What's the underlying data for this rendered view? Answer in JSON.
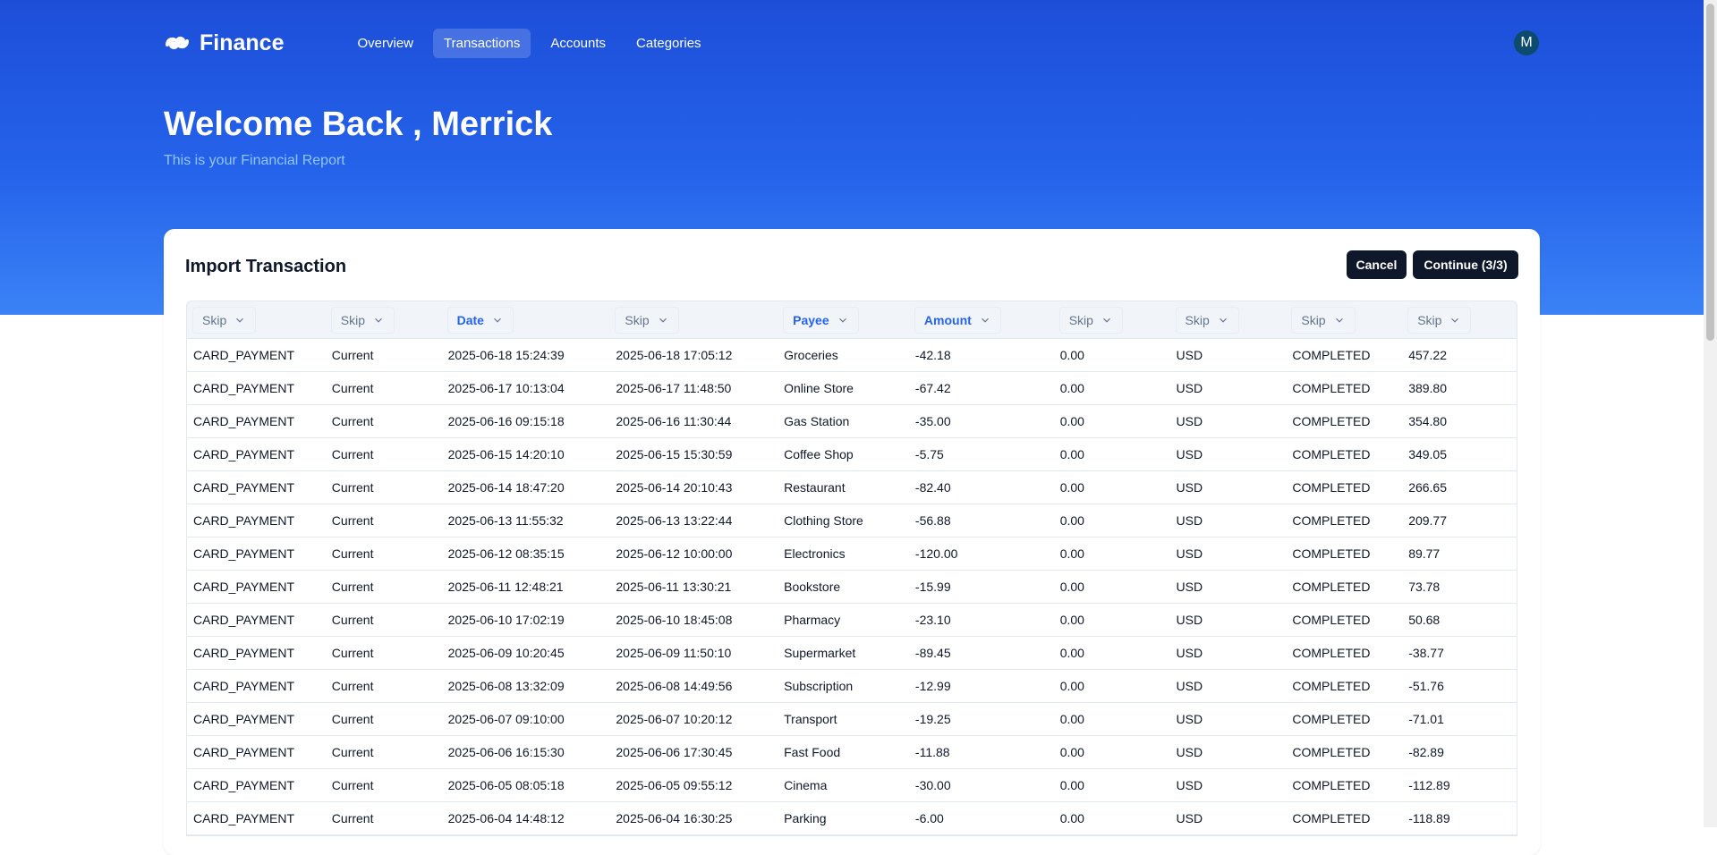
{
  "app": {
    "name": "Finance"
  },
  "nav": {
    "items": [
      {
        "label": "Overview"
      },
      {
        "label": "Transactions"
      },
      {
        "label": "Accounts"
      },
      {
        "label": "Categories"
      }
    ]
  },
  "user": {
    "initial": "M"
  },
  "header": {
    "welcome": "Welcome Back , Merrick",
    "subtitle": "This is your Financial Report"
  },
  "import": {
    "title": "Import Transaction",
    "cancel_label": "Cancel",
    "continue_label": "Continue (3/3)",
    "columns": [
      "Skip",
      "Skip",
      "Date",
      "Skip",
      "Payee",
      "Amount",
      "Skip",
      "Skip",
      "Skip",
      "Skip"
    ],
    "rows": [
      [
        "CARD_PAYMENT",
        "Current",
        "2025-06-18 15:24:39",
        "2025-06-18 17:05:12",
        "Groceries",
        "-42.18",
        "0.00",
        "USD",
        "COMPLETED",
        "457.22"
      ],
      [
        "CARD_PAYMENT",
        "Current",
        "2025-06-17 10:13:04",
        "2025-06-17 11:48:50",
        "Online Store",
        "-67.42",
        "0.00",
        "USD",
        "COMPLETED",
        "389.80"
      ],
      [
        "CARD_PAYMENT",
        "Current",
        "2025-06-16 09:15:18",
        "2025-06-16 11:30:44",
        "Gas Station",
        "-35.00",
        "0.00",
        "USD",
        "COMPLETED",
        "354.80"
      ],
      [
        "CARD_PAYMENT",
        "Current",
        "2025-06-15 14:20:10",
        "2025-06-15 15:30:59",
        "Coffee Shop",
        "-5.75",
        "0.00",
        "USD",
        "COMPLETED",
        "349.05"
      ],
      [
        "CARD_PAYMENT",
        "Current",
        "2025-06-14 18:47:20",
        "2025-06-14 20:10:43",
        "Restaurant",
        "-82.40",
        "0.00",
        "USD",
        "COMPLETED",
        "266.65"
      ],
      [
        "CARD_PAYMENT",
        "Current",
        "2025-06-13 11:55:32",
        "2025-06-13 13:22:44",
        "Clothing Store",
        "-56.88",
        "0.00",
        "USD",
        "COMPLETED",
        "209.77"
      ],
      [
        "CARD_PAYMENT",
        "Current",
        "2025-06-12 08:35:15",
        "2025-06-12 10:00:00",
        "Electronics",
        "-120.00",
        "0.00",
        "USD",
        "COMPLETED",
        "89.77"
      ],
      [
        "CARD_PAYMENT",
        "Current",
        "2025-06-11 12:48:21",
        "2025-06-11 13:30:21",
        "Bookstore",
        "-15.99",
        "0.00",
        "USD",
        "COMPLETED",
        "73.78"
      ],
      [
        "CARD_PAYMENT",
        "Current",
        "2025-06-10 17:02:19",
        "2025-06-10 18:45:08",
        "Pharmacy",
        "-23.10",
        "0.00",
        "USD",
        "COMPLETED",
        "50.68"
      ],
      [
        "CARD_PAYMENT",
        "Current",
        "2025-06-09 10:20:45",
        "2025-06-09 11:50:10",
        "Supermarket",
        "-89.45",
        "0.00",
        "USD",
        "COMPLETED",
        "-38.77"
      ],
      [
        "CARD_PAYMENT",
        "Current",
        "2025-06-08 13:32:09",
        "2025-06-08 14:49:56",
        "Subscription",
        "-12.99",
        "0.00",
        "USD",
        "COMPLETED",
        "-51.76"
      ],
      [
        "CARD_PAYMENT",
        "Current",
        "2025-06-07 09:10:00",
        "2025-06-07 10:20:12",
        "Transport",
        "-19.25",
        "0.00",
        "USD",
        "COMPLETED",
        "-71.01"
      ],
      [
        "CARD_PAYMENT",
        "Current",
        "2025-06-06 16:15:30",
        "2025-06-06 17:30:45",
        "Fast Food",
        "-11.88",
        "0.00",
        "USD",
        "COMPLETED",
        "-82.89"
      ],
      [
        "CARD_PAYMENT",
        "Current",
        "2025-06-05 08:05:18",
        "2025-06-05 09:55:12",
        "Cinema",
        "-30.00",
        "0.00",
        "USD",
        "COMPLETED",
        "-112.89"
      ],
      [
        "CARD_PAYMENT",
        "Current",
        "2025-06-04 14:48:12",
        "2025-06-04 16:30:25",
        "Parking",
        "-6.00",
        "0.00",
        "USD",
        "COMPLETED",
        "-118.89"
      ]
    ]
  }
}
